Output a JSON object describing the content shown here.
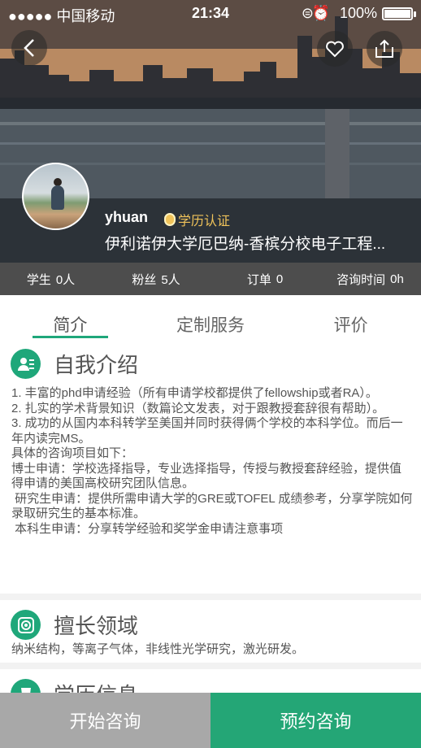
{
  "status_bar": {
    "carrier": "●●●●● 中国移动",
    "time": "21:34",
    "battery": "100%"
  },
  "profile": {
    "name": "yhuan",
    "certification": "学历认证",
    "school": "伊利诺伊大学厄巴纳-香槟分校电子工程..."
  },
  "stats": [
    {
      "label": "学生",
      "value": "0人"
    },
    {
      "label": "粉丝",
      "value": "5人"
    },
    {
      "label": "订单",
      "value": "0"
    },
    {
      "label": "咨询时间",
      "value": "0h"
    }
  ],
  "tabs": [
    {
      "label": "简介"
    },
    {
      "label": "定制服务"
    },
    {
      "label": "评价"
    }
  ],
  "intro": {
    "title": "自我介绍",
    "body": "1. 丰富的phd申请经验（所有申请学校都提供了fellowship或者RA）。\n2. 扎实的学术背景知识（数篇论文发表，对于跟教授套辞很有帮助）。\n3. 成功的从国内本科转学至美国并同时获得俩个学校的本科学位。而后一年内读完MS。\n具体的咨询项目如下：\n博士申请：学校选择指导，专业选择指导，传授与教授套辞经验，提供值得申请的美国高校研究团队信息。\n 研究生申请：提供所需申请大学的GRE或TOFEL 成绩参考，分享学院如何录取研究生的基本标准。\n 本科生申请：分享转学经验和奖学金申请注意事项"
  },
  "field": {
    "title": "擅长领域",
    "body": "纳米结构，等离子气体，非线性光学研究，激光研发。"
  },
  "education": {
    "title": "学历信息"
  },
  "bottom": {
    "start_label": "开始咨询",
    "book_label": "预约咨询"
  },
  "colors": {
    "accent": "#1fa77a",
    "stats_bg": "#4d4d4d",
    "start_button": "#a8a8a8",
    "book_button": "#24a676",
    "cert": "#f0c35a"
  }
}
